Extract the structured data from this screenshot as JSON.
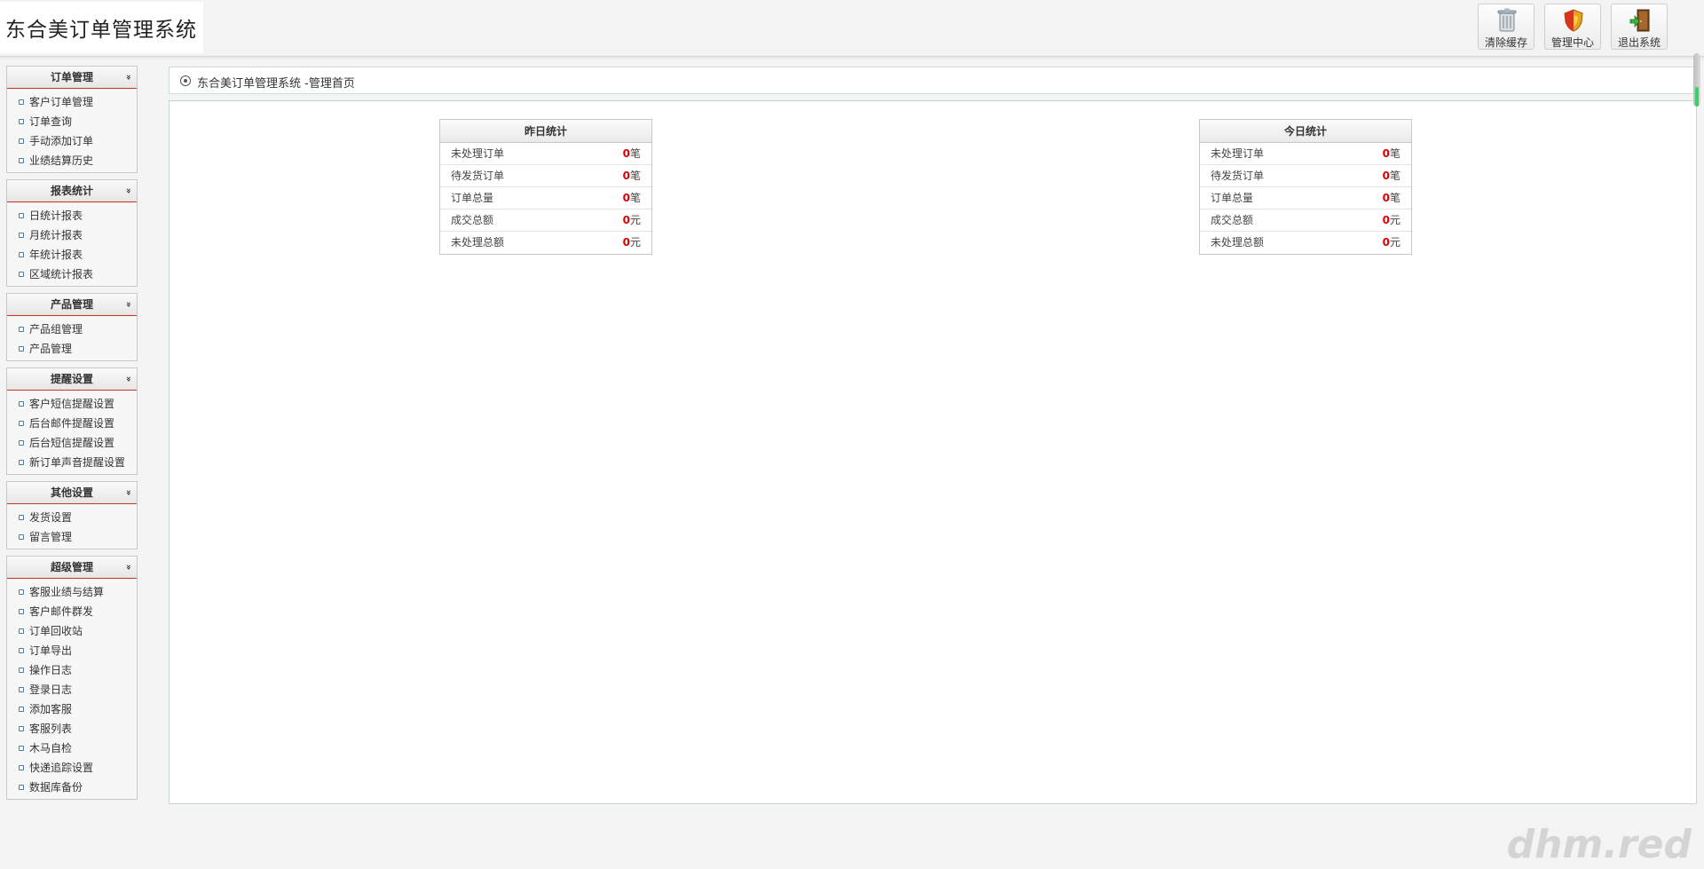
{
  "header": {
    "title": "东合美订单管理系统",
    "buttons": [
      {
        "label": "清除缓存",
        "icon": "trash-can-icon"
      },
      {
        "label": "管理中心",
        "icon": "shield-icon"
      },
      {
        "label": "退出系统",
        "icon": "exit-door-icon"
      }
    ]
  },
  "sidebar": {
    "groups": [
      {
        "title": "订单管理",
        "chevron": "»",
        "items": [
          "客户订单管理",
          "订单查询",
          "手动添加订单",
          "业绩结算历史"
        ]
      },
      {
        "title": "报表统计",
        "chevron": "»",
        "items": [
          "日统计报表",
          "月统计报表",
          "年统计报表",
          "区域统计报表"
        ]
      },
      {
        "title": "产品管理",
        "chevron": "»",
        "items": [
          "产品组管理",
          "产品管理"
        ]
      },
      {
        "title": "提醒设置",
        "chevron": "»",
        "items": [
          "客户短信提醒设置",
          "后台邮件提醒设置",
          "后台短信提醒设置",
          "新订单声音提醒设置"
        ]
      },
      {
        "title": "其他设置",
        "chevron": "»",
        "items": [
          "发货设置",
          "留言管理"
        ]
      },
      {
        "title": "超级管理",
        "chevron": "»",
        "items": [
          "客服业绩与结算",
          "客户邮件群发",
          "订单回收站",
          "订单导出",
          "操作日志",
          "登录日志",
          "添加客服",
          "客服列表",
          "木马自检",
          "快递追踪设置",
          "数据库备份"
        ]
      }
    ]
  },
  "breadcrumb": {
    "text": "东合美订单管理系统 -管理首页"
  },
  "stats": [
    {
      "title": "昨日统计",
      "rows": [
        {
          "label": "未处理订单",
          "value": "0",
          "unit": "笔"
        },
        {
          "label": "待发货订单",
          "value": "0",
          "unit": "笔"
        },
        {
          "label": "订单总量",
          "value": "0",
          "unit": "笔"
        },
        {
          "label": "成交总额",
          "value": "0",
          "unit": "元"
        },
        {
          "label": "未处理总额",
          "value": "0",
          "unit": "元"
        }
      ]
    },
    {
      "title": "今日统计",
      "rows": [
        {
          "label": "未处理订单",
          "value": "0",
          "unit": "笔"
        },
        {
          "label": "待发货订单",
          "value": "0",
          "unit": "笔"
        },
        {
          "label": "订单总量",
          "value": "0",
          "unit": "笔"
        },
        {
          "label": "成交总额",
          "value": "0",
          "unit": "元"
        },
        {
          "label": "未处理总额",
          "value": "0",
          "unit": "元"
        }
      ]
    }
  ],
  "watermark": "dhm.red",
  "colors": {
    "value_red": "#e00000",
    "menu_divider": "#c0392b",
    "scroll_accent": "#38d06b"
  }
}
